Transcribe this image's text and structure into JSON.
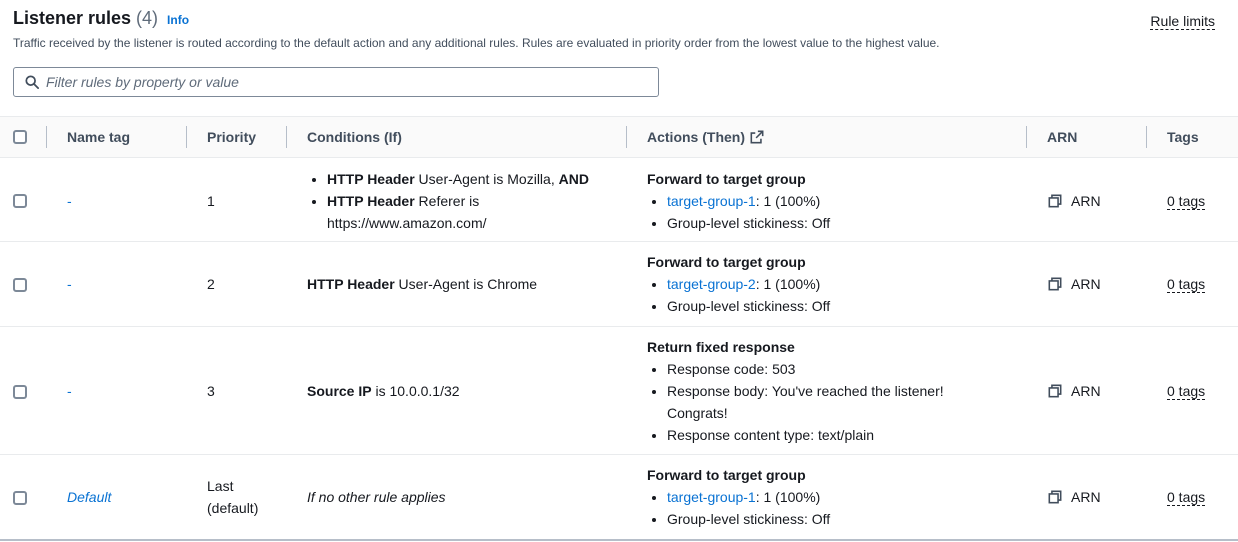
{
  "header": {
    "title": "Listener rules",
    "count": "(4)",
    "info": "Info",
    "subtitle": "Traffic received by the listener is routed according to the default action and any additional rules. Rules are evaluated in priority order from the lowest value to the highest value.",
    "rule_limits": "Rule limits"
  },
  "search": {
    "placeholder": "Filter rules by property or value",
    "icon": "search-icon"
  },
  "columns": {
    "name_tag": "Name tag",
    "priority": "Priority",
    "conditions": "Conditions (If)",
    "actions": "Actions (Then)",
    "arn": "ARN",
    "tags": "Tags"
  },
  "rows": [
    {
      "name": "-",
      "priority": "1",
      "conditions": [
        {
          "bold": "HTTP Header",
          "text": " User-Agent is Mozilla, ",
          "suffix_bold": "AND"
        },
        {
          "bold": "HTTP Header",
          "text": " Referer is https://www.amazon.com/"
        }
      ],
      "action_title": "Forward to target group",
      "action_target": "target-group-1",
      "action_target_rest": ": 1 (100%)",
      "action_stickiness": "Group-level stickiness: Off",
      "arn": "ARN",
      "tags": "0 tags"
    },
    {
      "name": "-",
      "priority": "2",
      "condition_bold": "HTTP Header",
      "condition_text": " User-Agent is Chrome",
      "action_title": "Forward to target group",
      "action_target": "target-group-2",
      "action_target_rest": ": 1 (100%)",
      "action_stickiness": "Group-level stickiness: Off",
      "arn": "ARN",
      "tags": "0 tags"
    },
    {
      "name": "-",
      "priority": "3",
      "condition_bold": "Source IP",
      "condition_text": " is 10.0.0.1/32",
      "action_title": "Return fixed response",
      "action_items": [
        "Response code: 503",
        "Response body: You've reached the listener! Congrats!",
        "Response content type: text/plain"
      ],
      "arn": "ARN",
      "tags": "0 tags"
    },
    {
      "name": "Default",
      "priority": "Last (default)",
      "condition_text": "If no other rule applies",
      "action_title": "Forward to target group",
      "action_target": "target-group-1",
      "action_target_rest": ": 1 (100%)",
      "action_stickiness": "Group-level stickiness: Off",
      "arn": "ARN",
      "tags": "0 tags"
    }
  ],
  "colors": {
    "link": "#0972d3",
    "text": "#16191f",
    "header_bg": "#fafafa",
    "border": "#e9ebed"
  }
}
